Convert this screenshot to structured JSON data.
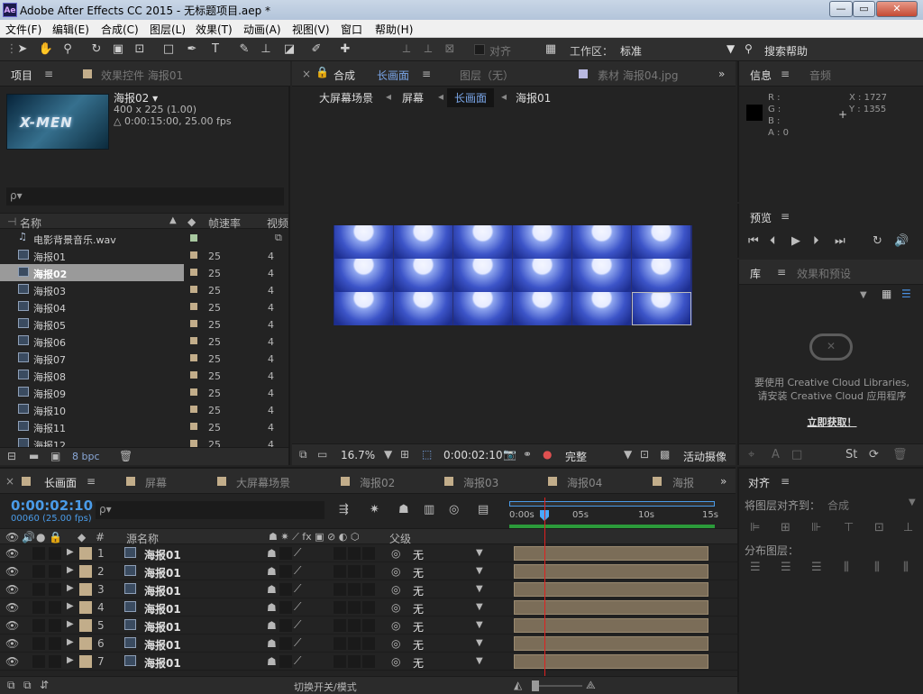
{
  "window": {
    "title": "Adobe After Effects CC 2015 - 无标题项目.aep *",
    "app_icon": "Ae",
    "min": "—",
    "max": "▭",
    "close": "✕"
  },
  "menu": [
    "文件(F)",
    "编辑(E)",
    "合成(C)",
    "图层(L)",
    "效果(T)",
    "动画(A)",
    "视图(V)",
    "窗口",
    "帮助(H)"
  ],
  "toolbar": {
    "align_label": "对齐",
    "workspace_label": "工作区：",
    "workspace_value": "标准",
    "search_help": "搜索帮助"
  },
  "project": {
    "tab": "项目",
    "tab2": "效果控件 海报01",
    "item_name": "海报02 ▾",
    "item_size": "400 x 225 (1.00)",
    "item_dur": "△ 0:00:15:00, 25.00 fps",
    "thumb_text": "X-MEN",
    "search_icon": "ρ▾",
    "col_name": "名称",
    "col_fps": "帧速率",
    "col_dur": "视频",
    "footer_bpc": "8 bpc",
    "items": [
      {
        "name": "电影背景音乐.wav",
        "fps": "",
        "dur": "",
        "audio": true
      },
      {
        "name": "海报01",
        "fps": "25",
        "dur": "4"
      },
      {
        "name": "海报02",
        "fps": "25",
        "dur": "4",
        "selected": true
      },
      {
        "name": "海报03",
        "fps": "25",
        "dur": "4"
      },
      {
        "name": "海报04",
        "fps": "25",
        "dur": "4"
      },
      {
        "name": "海报05",
        "fps": "25",
        "dur": "4"
      },
      {
        "name": "海报06",
        "fps": "25",
        "dur": "4"
      },
      {
        "name": "海报07",
        "fps": "25",
        "dur": "4"
      },
      {
        "name": "海报08",
        "fps": "25",
        "dur": "4"
      },
      {
        "name": "海报09",
        "fps": "25",
        "dur": "4"
      },
      {
        "name": "海报10",
        "fps": "25",
        "dur": "4"
      },
      {
        "name": "海报11",
        "fps": "25",
        "dur": "4"
      },
      {
        "name": "海报12",
        "fps": "25",
        "dur": "4"
      }
    ]
  },
  "comp": {
    "tab_x": "×",
    "tab": "合成",
    "tab_name": "长画面",
    "tab_layer": "图层（无）",
    "tab_footage": "素材 海报04.jpg",
    "breadcrumbs": [
      "大屏幕场景",
      "屏幕",
      "长画面",
      "海报01"
    ],
    "zoom": "16.7%",
    "time": "0:00:02:10",
    "quality": "完整",
    "camera": "活动摄像"
  },
  "info": {
    "tab": "信息",
    "tab2": "音频",
    "r": "R :",
    "g": "G :",
    "b": "B :",
    "a": "A : 0",
    "x": "X : 1727",
    "y": "Y : 1355"
  },
  "preview": {
    "tab": "预览"
  },
  "library": {
    "tab": "库",
    "tab2": "效果和预设",
    "msg1": "要使用 Creative Cloud Libraries,",
    "msg2": "请安装 Creative Cloud 应用程序",
    "link": "立即获取！"
  },
  "align": {
    "tab": "对齐",
    "align_to_label": "将图层对齐到：",
    "align_to_value": "合成",
    "distribute": "分布图层："
  },
  "timeline": {
    "tabs": [
      "长画面",
      "屏幕",
      "大屏幕场景",
      "海报02",
      "海报03",
      "海报04",
      "海报"
    ],
    "time": "0:00:02:10",
    "frames": "00060 (25.00 fps)",
    "col_src": "源名称",
    "col_parent": "父级",
    "ruler": [
      "0:00s",
      "05s",
      "10s",
      "15s"
    ],
    "footer": "切换开关/模式",
    "layers": [
      {
        "num": "1",
        "name": "海报01",
        "parent": "无"
      },
      {
        "num": "2",
        "name": "海报01",
        "parent": "无"
      },
      {
        "num": "3",
        "name": "海报01",
        "parent": "无"
      },
      {
        "num": "4",
        "name": "海报01",
        "parent": "无"
      },
      {
        "num": "5",
        "name": "海报01",
        "parent": "无"
      },
      {
        "num": "6",
        "name": "海报01",
        "parent": "无"
      },
      {
        "num": "7",
        "name": "海报01",
        "parent": "无"
      }
    ]
  }
}
